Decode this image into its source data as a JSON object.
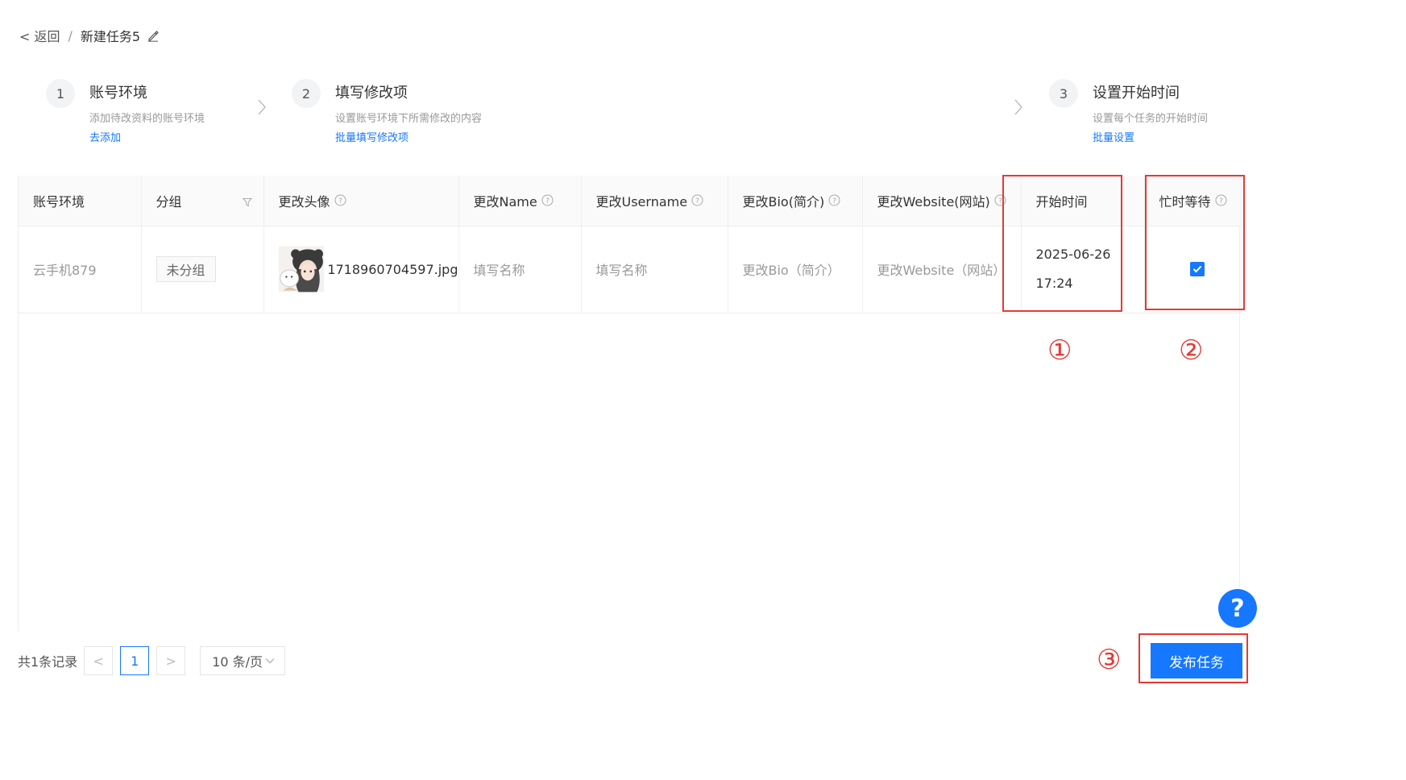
{
  "breadcrumb": {
    "back": "< 返回",
    "separator": "/",
    "task_name": "新建任务5"
  },
  "steps": [
    {
      "num": "1",
      "title": "账号环境",
      "desc": "添加待改资料的账号环境",
      "link": "去添加"
    },
    {
      "num": "2",
      "title": "填写修改项",
      "desc": "设置账号环境下所需修改的内容",
      "link": "批量填写修改项"
    },
    {
      "num": "3",
      "title": "设置开始时间",
      "desc": "设置每个任务的开始时间",
      "link": "批量设置"
    }
  ],
  "table": {
    "columns": [
      "账号环境",
      "分组",
      "更改头像",
      "更改Name",
      "更改Username",
      "更改Bio(简介)",
      "更改Website(网站)",
      "开始时间",
      "忙时等待"
    ],
    "rows": [
      {
        "account": "云手机879",
        "group": "未分组",
        "avatar_file": "1718960704597.jpg",
        "name_placeholder": "填写名称",
        "username_placeholder": "填写名称",
        "bio_placeholder": "更改Bio（简介）",
        "website_placeholder": "更改Website（网站）",
        "start_date": "2025-06-26",
        "start_time": "17:24",
        "busy_wait_checked": true
      }
    ]
  },
  "annotations": {
    "one": "①",
    "two": "②",
    "three": "③",
    "color": "#e53935"
  },
  "pagination": {
    "total": "共1条记录",
    "prev": "<",
    "current": "1",
    "next": ">",
    "page_size": "10 条/页"
  },
  "actions": {
    "help": "?",
    "publish": "发布任务"
  },
  "colors": {
    "primary": "#1677ff",
    "header_bg": "#fafafa"
  }
}
